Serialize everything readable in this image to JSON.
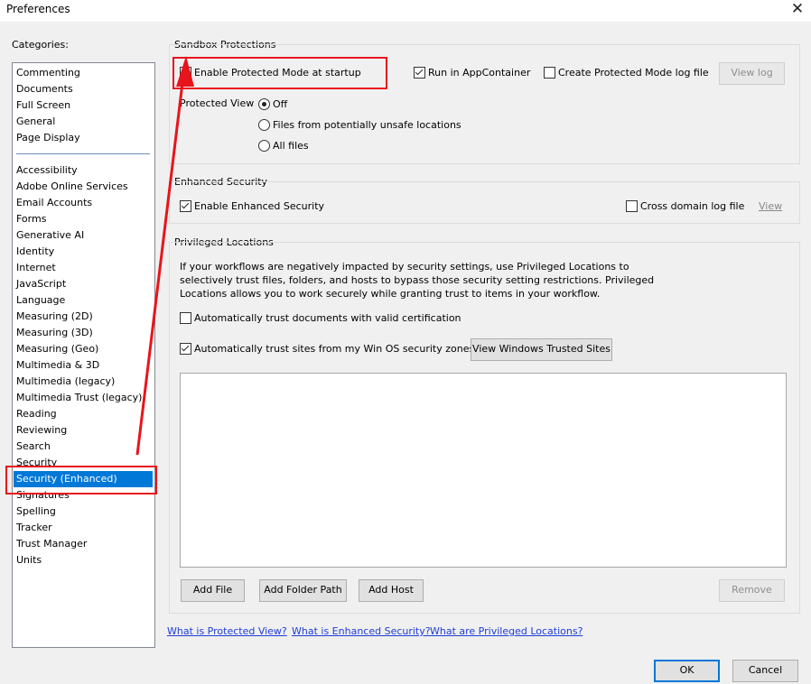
{
  "window": {
    "title": "Preferences"
  },
  "categories_label": "Categories:",
  "categories": [
    "Commenting",
    "Documents",
    "Full Screen",
    "General",
    "Page Display",
    "Accessibility",
    "Adobe Online Services",
    "Email Accounts",
    "Forms",
    "Generative AI",
    "Identity",
    "Internet",
    "JavaScript",
    "Language",
    "Measuring (2D)",
    "Measuring (3D)",
    "Measuring (Geo)",
    "Multimedia & 3D",
    "Multimedia (legacy)",
    "Multimedia Trust (legacy)",
    "Reading",
    "Reviewing",
    "Search",
    "Security",
    "Security (Enhanced)",
    "Signatures",
    "Spelling",
    "Tracker",
    "Trust Manager",
    "Units"
  ],
  "selected_category": "Security (Enhanced)",
  "sandbox": {
    "title": "Sandbox Protections",
    "enable_protected_mode": "Enable Protected Mode at startup",
    "run_in_appcontainer": "Run in AppContainer",
    "create_log": "Create Protected Mode log file",
    "view_log": "View log",
    "protected_view_label": "Protected View",
    "pv_off": "Off",
    "pv_unsafe": "Files from potentially unsafe locations",
    "pv_all": "All files"
  },
  "enhanced": {
    "title": "Enhanced Security",
    "enable": "Enable Enhanced Security",
    "cross_domain": "Cross domain log file",
    "view": "View"
  },
  "privileged": {
    "title": "Privileged Locations",
    "desc1": "If your workflows are negatively impacted by security settings, use Privileged Locations to",
    "desc2": "selectively trust files, folders, and hosts to bypass those security setting restrictions. Privileged",
    "desc3": "Locations allows you to work securely while granting trust to items in your workflow.",
    "auto_cert": "Automatically trust documents with valid certification",
    "auto_sites": "Automatically trust sites from my Win OS security zones",
    "view_trusted": "View Windows Trusted Sites",
    "add_file": "Add File",
    "add_folder": "Add Folder Path",
    "add_host": "Add Host",
    "remove": "Remove"
  },
  "links": {
    "protected_view": "What is Protected View?",
    "enhanced_security": "What is Enhanced Security?",
    "privileged_locations": "What are Privileged Locations?"
  },
  "buttons": {
    "ok": "OK",
    "cancel": "Cancel"
  },
  "annotation_color": "#e8141c"
}
